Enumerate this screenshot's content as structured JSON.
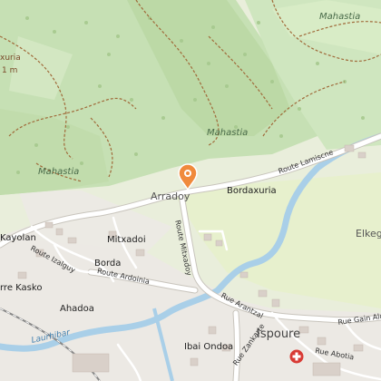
{
  "map": {
    "areas": {
      "mahastia_top": "Mahastia",
      "mahastia_mid": "Mahastia",
      "mahastia_left": "Mahastia",
      "elkega": "Elkeg"
    },
    "places": {
      "arradoy": "Arradoy",
      "bordaxuria": "Bordaxuria",
      "kayolan": "Kayolan",
      "mitxadoi": "Mitxadoi",
      "borda": "Borda",
      "ahadoa": "Ahadoa",
      "kasko": "rre Kasko",
      "ibai_ondoa": "Ibai Ondoa",
      "ispoure": "Ispoure",
      "xuria": "xuria",
      "elev": "1 m"
    },
    "roads": {
      "lamiscane": "Route Lamiscne",
      "mitxadoy": "Route Mitxadoy",
      "izalguy": "Route Izalguy",
      "ardoinia": "Route Ardoinia",
      "arantzal": "Rue Arantzal",
      "zankarte": "Rue Zankarte",
      "gain_aldea": "Rue Gain Ald",
      "abotia": "Rue Abotia"
    },
    "water": {
      "laurhibar": "Laurhibar"
    },
    "icons": {
      "marker": "location-pin-icon",
      "poi": "pharmacy-cross-icon"
    },
    "colors": {
      "forest": "#c6e0b4",
      "forest_dark": "#b9d7a4",
      "meadow": "#e6f0cc",
      "urban": "#ebe8e4",
      "river": "#a9cfe8",
      "road": "#ffffff",
      "marker": "#f08a3c",
      "poi": "#d83a34",
      "track": "#a06a3a"
    }
  }
}
